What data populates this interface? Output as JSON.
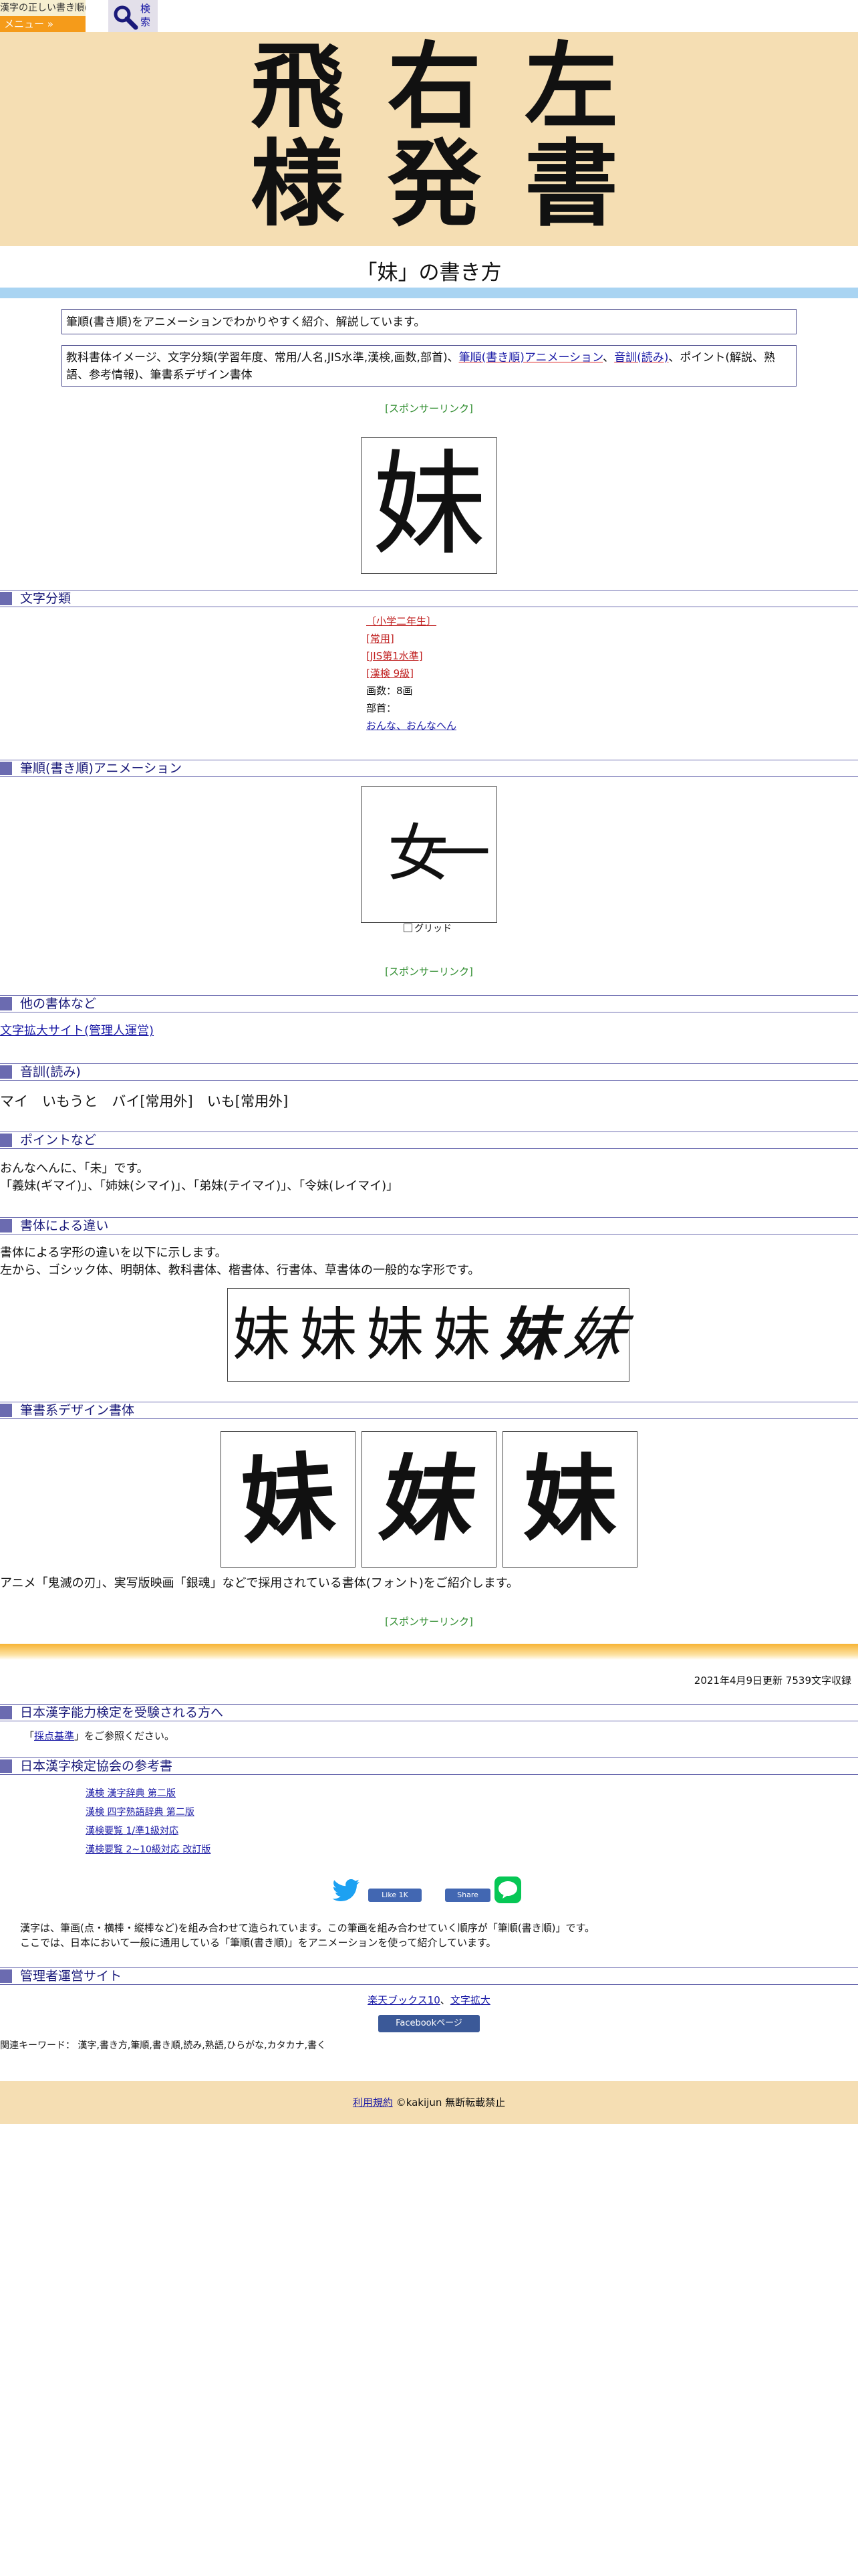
{
  "header": {
    "logo_text": "漢字の正しい書き順(筆順)",
    "menu_label": "メニュー »",
    "search_label": "検索"
  },
  "hero": {
    "row1": [
      "飛",
      "右",
      "左"
    ],
    "row2": [
      "様",
      "発",
      "書"
    ]
  },
  "page_title": "「妹」の書き方",
  "intro": "筆順(書き順)をアニメーションでわかりやすく紹介、解説しています。",
  "index": {
    "lead": "教科書体イメージ、文字分類(学習年度、常用/人名,JIS水準,漢検,画数,部首)、",
    "link1": "筆順(書き順)アニメーション",
    "sep1": "、",
    "link2": "音訓(読み)",
    "tail": "、ポイント(解説、熟語、参考情報)、筆書系デザイン書体"
  },
  "sponsor_label": "[スポンサーリンク]",
  "main_char": "妹",
  "sections": {
    "classification": "文字分類",
    "animation": "筆順(書き順)アニメーション",
    "other_fonts": "他の書体など",
    "reading": "音訓(読み)",
    "points": "ポイントなど",
    "font_diff": "書体による違い",
    "design_fonts": "筆書系デザイン書体",
    "kentei_takers": "日本漢字能力検定を受験される方へ",
    "kentei_refs": "日本漢字検定協会の参考書",
    "admin_sites": "管理者運営サイト"
  },
  "classification": {
    "grade": "〔小学二年生〕",
    "joyo": "[常用]",
    "jis": "[JIS第1水準]",
    "kanken": "[漢検 9級]",
    "strokes": "画数：8画",
    "radical_label": "部首：",
    "radical": "おんな、おんなへん"
  },
  "animation": {
    "partial_char": "女一",
    "grid_label": "グリッド"
  },
  "other_fonts_link": "文字拡大サイト(管理人運営)",
  "reading_text": "マイ　いもうと　バイ[常用外]　いも[常用外]",
  "points": {
    "line1": "おんなへんに、「未」です。",
    "line2": "「義妹(ギマイ)」、「姉妹(シマイ)」、「弟妹(テイマイ)」、「令妹(レイマイ)」"
  },
  "font_diff": {
    "line1": "書体による字形の違いを以下に示します。",
    "line2": "左から、ゴシック体、明朝体、教科書体、楷書体、行書体、草書体の一般的な字形です。"
  },
  "design_caption": "アニメ「鬼滅の刃」、実写版映画「銀魂」などで採用されている書体(フォント)をご紹介します。",
  "updated": "2021年4月9日更新 7539文字収録",
  "kentei": {
    "note_open": "「",
    "note_link": "採点基準",
    "note_close": "」をご参照ください。"
  },
  "books": [
    "漢検 漢字辞典 第二版",
    "漢検 四字熟語辞典 第二版",
    "漢検要覧 1/準1級対応",
    "漢検要覧 2~10級対応 改訂版"
  ],
  "share": {
    "like": "Like 1K",
    "share": "Share"
  },
  "about": {
    "line1": "漢字は、筆画(点・横棒・縦棒など)を組み合わせて造られています。この筆画を組み合わせていく順序が「筆順(書き順)」です。",
    "line2": "ここでは、日本において一般に通用している「筆順(書き順)」をアニメーションを使って紹介しています。"
  },
  "admin": {
    "link1": "楽天ブックス10",
    "sep": "、",
    "link2": "文字拡大",
    "fb": "Facebookページ"
  },
  "keywords": "関連キーワード： 漢字,書き方,筆順,書き順,読み,熟語,ひらがな,カタカナ,書く",
  "footer": {
    "terms": "利用規約",
    "copyright": "©kakijun 無断転載禁止"
  }
}
